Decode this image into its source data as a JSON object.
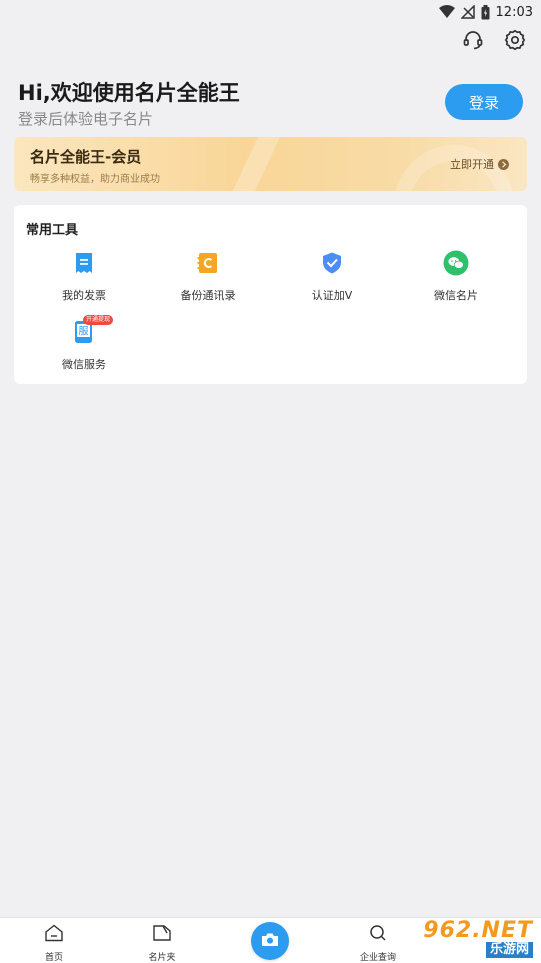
{
  "status_bar": {
    "time": "12:03"
  },
  "header": {
    "greeting": "Hi,欢迎使用名片全能王",
    "subtitle": "登录后体验电子名片",
    "login_label": "登录"
  },
  "vip": {
    "title": "名片全能王-会员",
    "description": "畅享多种权益，助力商业成功",
    "cta": "立即开通"
  },
  "tools": {
    "title": "常用工具",
    "items": [
      {
        "label": "我的发票",
        "icon": "invoice-icon"
      },
      {
        "label": "备份通讯录",
        "icon": "backup-contacts-icon"
      },
      {
        "label": "认证加V",
        "icon": "verify-shield-icon"
      },
      {
        "label": "微信名片",
        "icon": "wechat-icon"
      },
      {
        "label": "微信服务",
        "icon": "wechat-service-icon",
        "badge": "开通提现"
      }
    ]
  },
  "nav": {
    "items": [
      {
        "label": "首页",
        "icon": "home-icon"
      },
      {
        "label": "名片夹",
        "icon": "card-folder-icon"
      },
      {
        "label": "企业查询",
        "icon": "search-icon"
      }
    ],
    "camera_icon": "camera-icon"
  },
  "watermark": {
    "top": "962.NET",
    "bottom": "乐游网"
  },
  "colors": {
    "accent": "#2b9cf0",
    "vip_gold": "#f9d698",
    "badge_red": "#f04a3e"
  }
}
